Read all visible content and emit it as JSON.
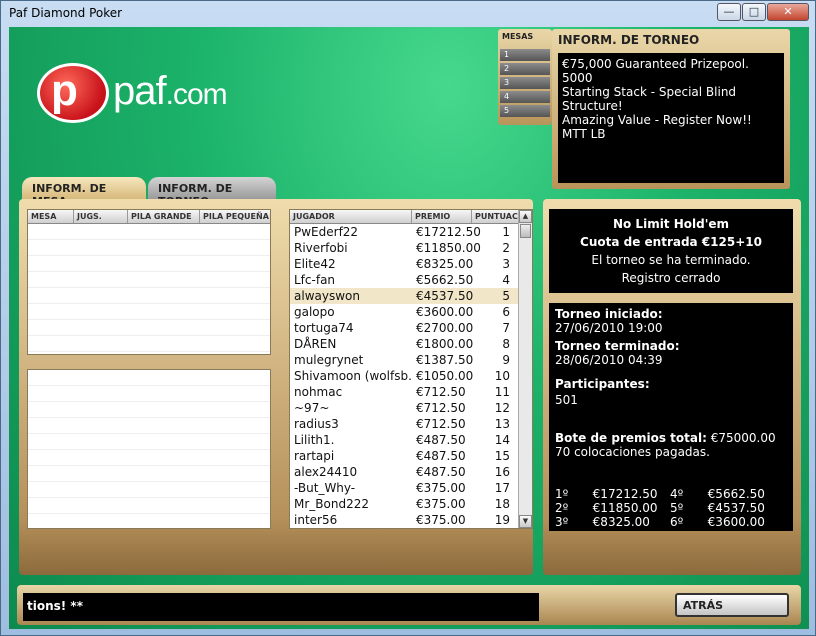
{
  "window": {
    "title": "Paf Diamond Poker",
    "min": "—",
    "max": "□",
    "close": "✕"
  },
  "logo": {
    "p": "p",
    "text": "paf",
    "suffix": ".com"
  },
  "mesas": {
    "header": "MESAS",
    "items": [
      "1",
      "2",
      "3",
      "4",
      "5"
    ]
  },
  "torneo_info": {
    "header": "INFORM. DE TORNEO",
    "lines": [
      "€75,000 Guaranteed Prizepool.  5000",
      "Starting Stack - Special Blind Structure!",
      "Amazing Value - Register Now!!  MTT LB"
    ]
  },
  "tabs": [
    "INFORM. DE MESA",
    "INFORM. DE TORNEO"
  ],
  "tables_grid": {
    "columns": [
      "MESA",
      "JUGS.",
      "PILA GRANDE",
      "PILA PEQUEÑA"
    ]
  },
  "players": {
    "columns": [
      "JUGADOR",
      "PREMIO",
      "PUNTUACIÓN"
    ],
    "rows": [
      {
        "name": "PwEderf22",
        "prize": "€17212.50",
        "pos": "1"
      },
      {
        "name": "Riverfobi",
        "prize": "€11850.00",
        "pos": "2"
      },
      {
        "name": "Elite42",
        "prize": "€8325.00",
        "pos": "3"
      },
      {
        "name": "Lfc-fan",
        "prize": "€5662.50",
        "pos": "4"
      },
      {
        "name": "alwayswon",
        "prize": "€4537.50",
        "pos": "5"
      },
      {
        "name": "galopo",
        "prize": "€3600.00",
        "pos": "6"
      },
      {
        "name": "tortuga74",
        "prize": "€2700.00",
        "pos": "7"
      },
      {
        "name": "DÅREN",
        "prize": "€1800.00",
        "pos": "8"
      },
      {
        "name": "mulegrynet",
        "prize": "€1387.50",
        "pos": "9"
      },
      {
        "name": "Shivamoon (wolfsb...",
        "prize": "€1050.00",
        "pos": "10"
      },
      {
        "name": "nohmac",
        "prize": "€712.50",
        "pos": "11"
      },
      {
        "name": "~97~",
        "prize": "€712.50",
        "pos": "12"
      },
      {
        "name": "radius3",
        "prize": "€712.50",
        "pos": "13"
      },
      {
        "name": "Lilith1.",
        "prize": "€487.50",
        "pos": "14"
      },
      {
        "name": "rartapi",
        "prize": "€487.50",
        "pos": "15"
      },
      {
        "name": "alex24410",
        "prize": "€487.50",
        "pos": "16"
      },
      {
        "name": "-But_Why-",
        "prize": "€375.00",
        "pos": "17"
      },
      {
        "name": "Mr_Bond222",
        "prize": "€375.00",
        "pos": "18"
      },
      {
        "name": "inter56",
        "prize": "€375.00",
        "pos": "19"
      }
    ],
    "selected_index": 4
  },
  "game": {
    "type": "No Limit Hold'em",
    "buyin": "Cuota de entrada €125+10",
    "status": "El torneo se ha terminado.",
    "registration": "Registro cerrado"
  },
  "details": {
    "started_label": "Torneo iniciado:",
    "started": "27/06/2010 19:00",
    "ended_label": "Torneo terminado:",
    "ended": "28/06/2010 04:39",
    "participants_label": "Participantes:",
    "participants": "501",
    "prizepool_label": "Bote de premios total:",
    "prizepool": "€75000.00",
    "paid": "70 colocaciones pagadas.",
    "prizes": [
      [
        "1º",
        "€17212.50",
        "4º",
        "€5662.50"
      ],
      [
        "2º",
        "€11850.00",
        "5º",
        "€4537.50"
      ],
      [
        "3º",
        "€8325.00",
        "6º",
        "€3600.00"
      ]
    ]
  },
  "bottom": {
    "chat_text": "tions! **",
    "back_button": "ATRÁS"
  }
}
